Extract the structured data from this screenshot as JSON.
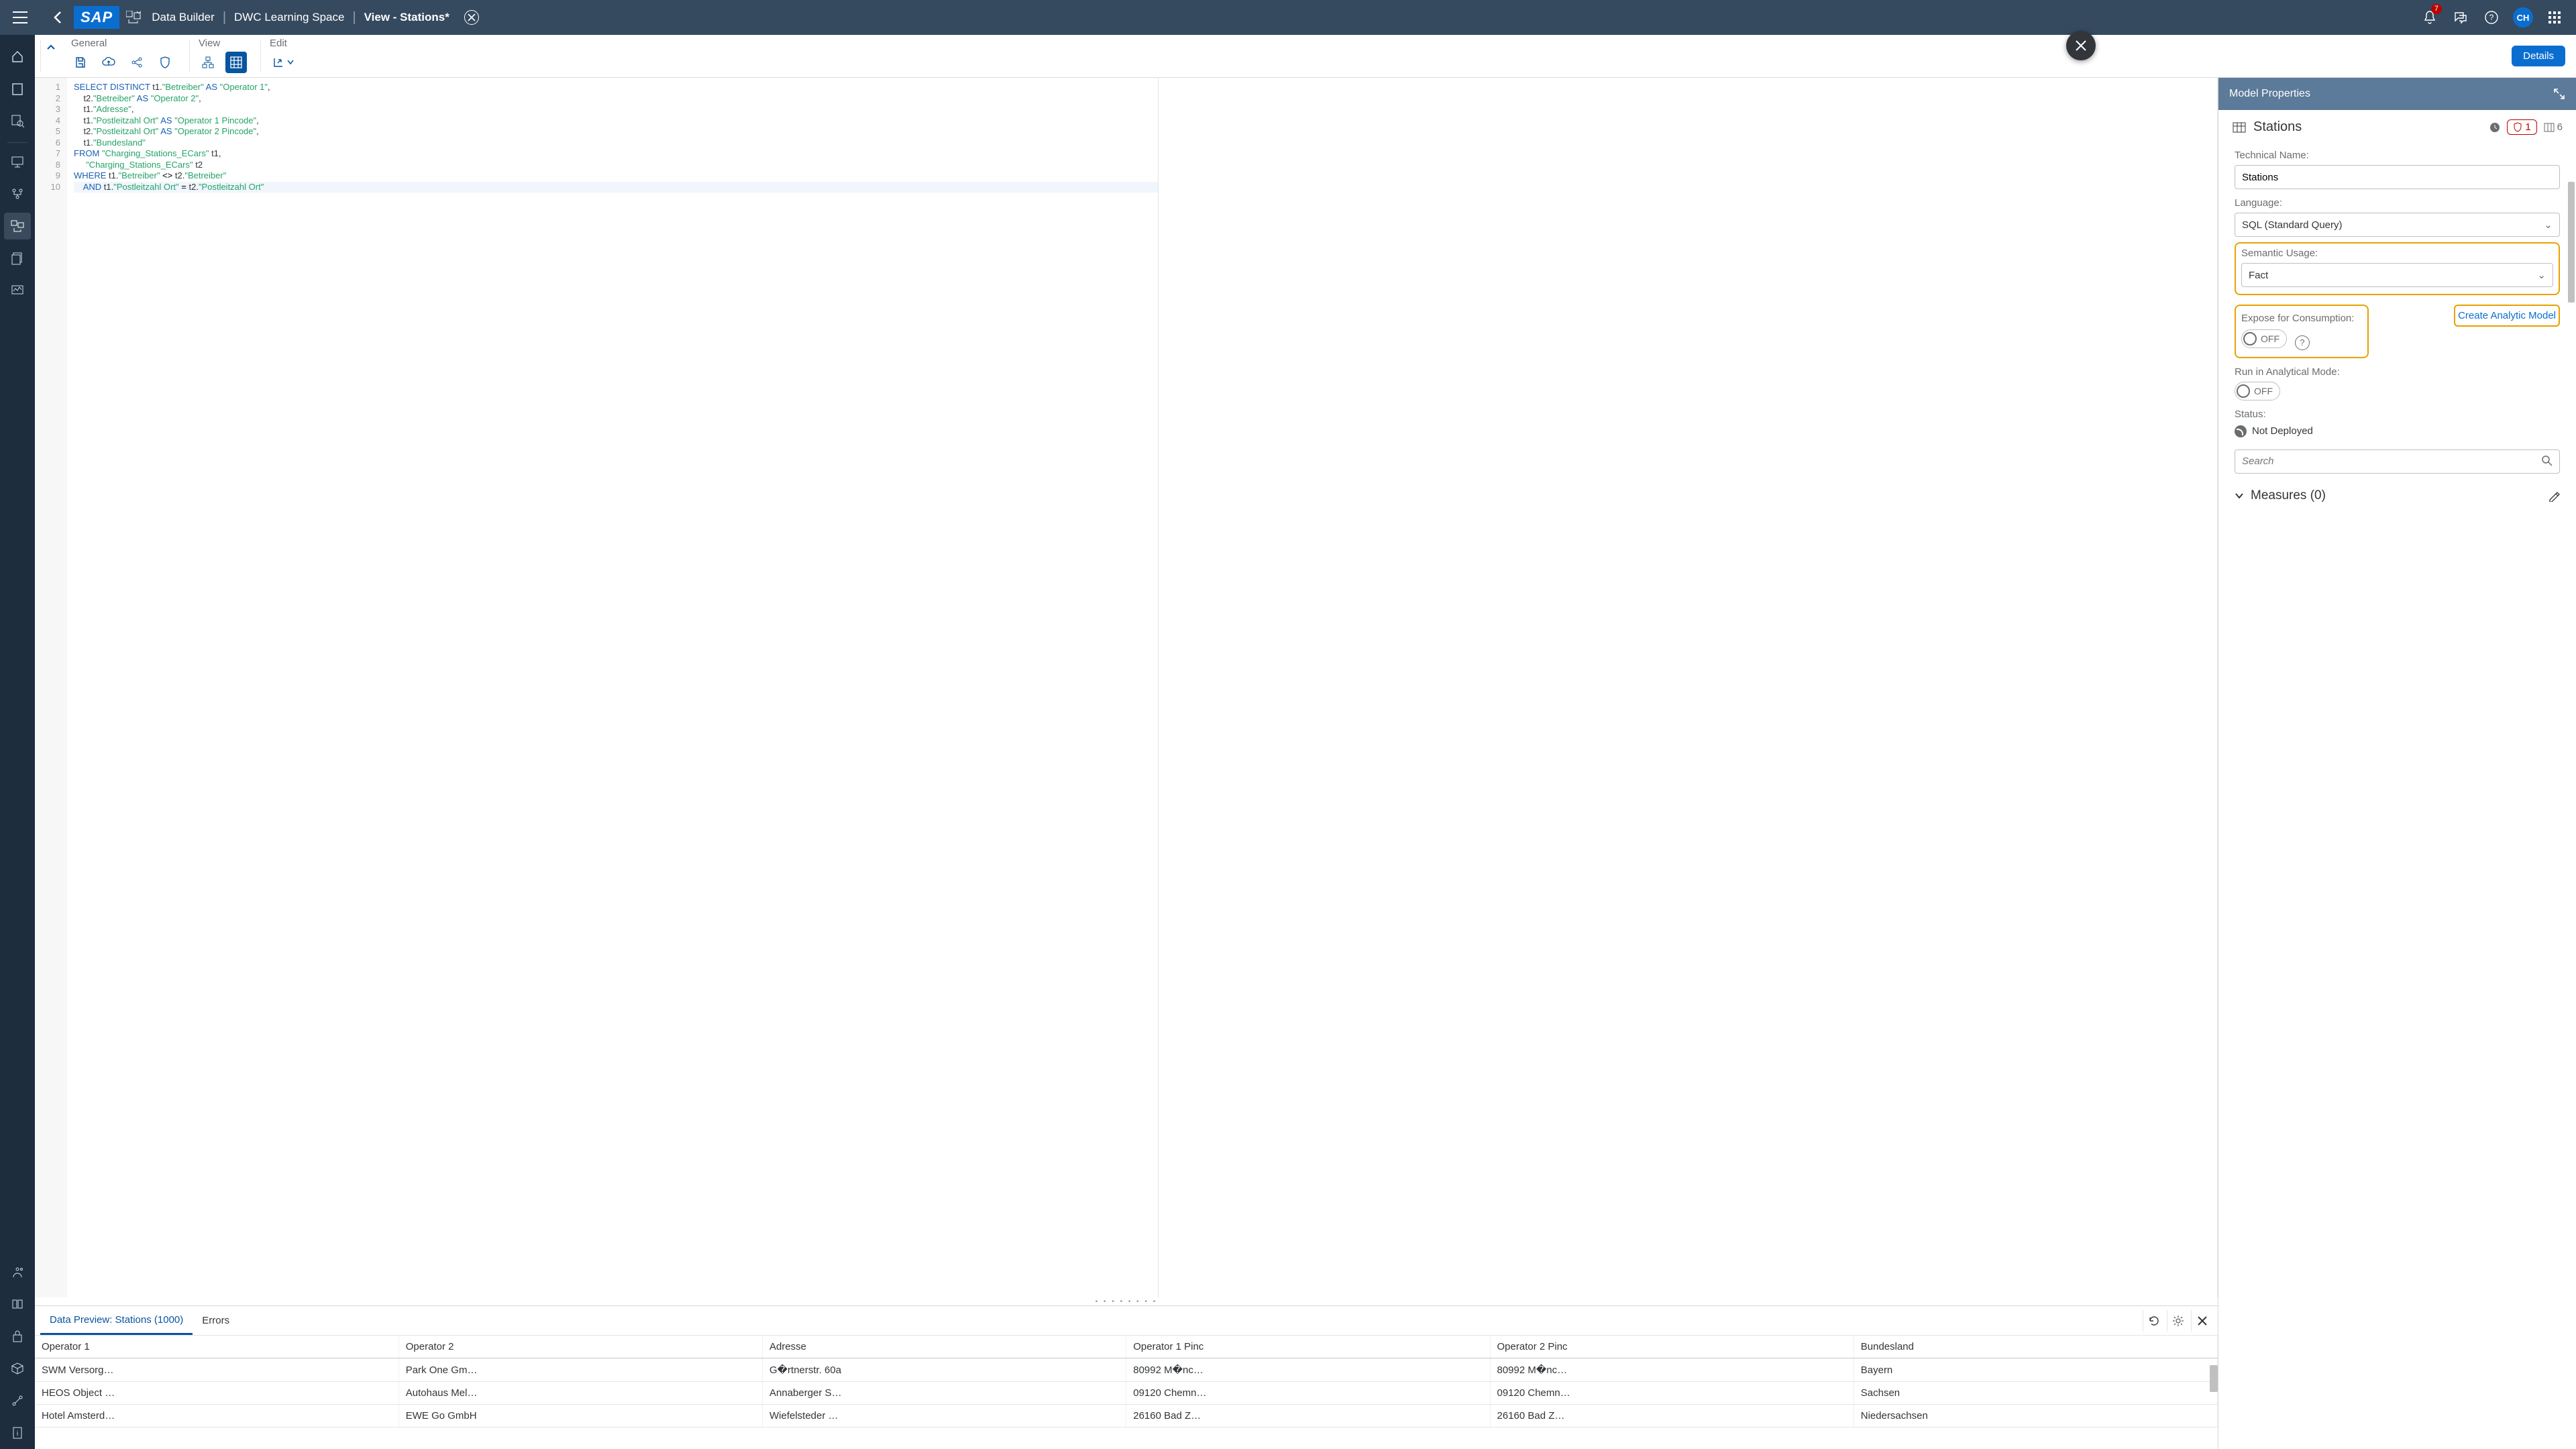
{
  "shell": {
    "logo": "SAP",
    "breadcrumb": {
      "app": "Data Builder",
      "space": "DWC Learning Space",
      "title": "View - Stations*"
    },
    "notifications_count": "7",
    "avatar": "CH"
  },
  "ribbon": {
    "general": "General",
    "view": "View",
    "edit": "Edit",
    "details_btn": "Details"
  },
  "sql": {
    "lines": [
      {
        "n": "1",
        "html": "<span class='kw'>SELECT</span> <span class='kw'>DISTINCT</span> t1.<span class='str'>\"Betreiber\"</span> <span class='kw'>AS</span> <span class='str'>\"Operator 1\"</span>,"
      },
      {
        "n": "2",
        "html": "    t2.<span class='str'>\"Betreiber\"</span> <span class='kw'>AS</span> <span class='str'>\"Operator 2\"</span>,"
      },
      {
        "n": "3",
        "html": "    t1.<span class='str'>\"Adresse\"</span>,"
      },
      {
        "n": "4",
        "html": "    t1.<span class='str'>\"Postleitzahl Ort\"</span> <span class='kw'>AS</span> <span class='str'>\"Operator 1 Pincode\"</span>,"
      },
      {
        "n": "5",
        "html": "    t2.<span class='str'>\"Postleitzahl Ort\"</span> <span class='kw'>AS</span> <span class='str'>\"Operator 2 Pincode\"</span>,"
      },
      {
        "n": "6",
        "html": "    t1.<span class='str'>\"Bundesland\"</span>"
      },
      {
        "n": "7",
        "html": "<span class='kw'>FROM</span> <span class='str'>\"Charging_Stations_ECars\"</span> t1,"
      },
      {
        "n": "8",
        "html": "     <span class='str'>\"Charging_Stations_ECars\"</span> t2"
      },
      {
        "n": "9",
        "html": "<span class='kw'>WHERE</span> t1.<span class='str'>\"Betreiber\"</span> <span class='op'>&lt;&gt;</span> t2.<span class='str'>\"Betreiber\"</span>"
      },
      {
        "n": "10",
        "html": "    <span class='kw'>AND</span> t1.<span class='str'>\"Postleitzahl Ort\"</span> <span class='op'>=</span> t2.<span class='str'>\"Postleitzahl Ort\"</span>",
        "hl": true
      }
    ]
  },
  "preview": {
    "tab_active": "Data Preview: Stations (1000)",
    "tab_errors": "Errors",
    "columns": [
      "Operator 1",
      "Operator 2",
      "Adresse",
      "Operator 1 Pinc",
      "Operator 2 Pinc",
      "Bundesland"
    ],
    "rows": [
      [
        "SWM Versorg…",
        "Park One Gm…",
        "G�rtnerstr. 60a",
        "80992 M�nc…",
        "80992 M�nc…",
        "Bayern"
      ],
      [
        "HEOS Object …",
        "Autohaus Mel…",
        "Annaberger S…",
        "09120 Chemn…",
        "09120 Chemn…",
        "Sachsen"
      ],
      [
        "Hotel Amsterd…",
        "EWE Go GmbH",
        "Wiefelsteder …",
        "26160 Bad Z…",
        "26160 Bad Z…",
        "Niedersachsen"
      ]
    ]
  },
  "props": {
    "header": "Model Properties",
    "title": "Stations",
    "badge_warn": "1",
    "badge_cols": "6",
    "tech_name_label": "Technical Name:",
    "tech_name_value": "Stations",
    "language_label": "Language:",
    "language_value": "SQL (Standard Query)",
    "semantic_label": "Semantic Usage:",
    "semantic_value": "Fact",
    "expose_label": "Expose for Consumption:",
    "off": "OFF",
    "analytic_link": "Create Analytic Model",
    "run_analytical_label": "Run in Analytical Mode:",
    "status_label": "Status:",
    "status_value": "Not Deployed",
    "search_placeholder": "Search",
    "measures_title": "Measures (0)"
  }
}
